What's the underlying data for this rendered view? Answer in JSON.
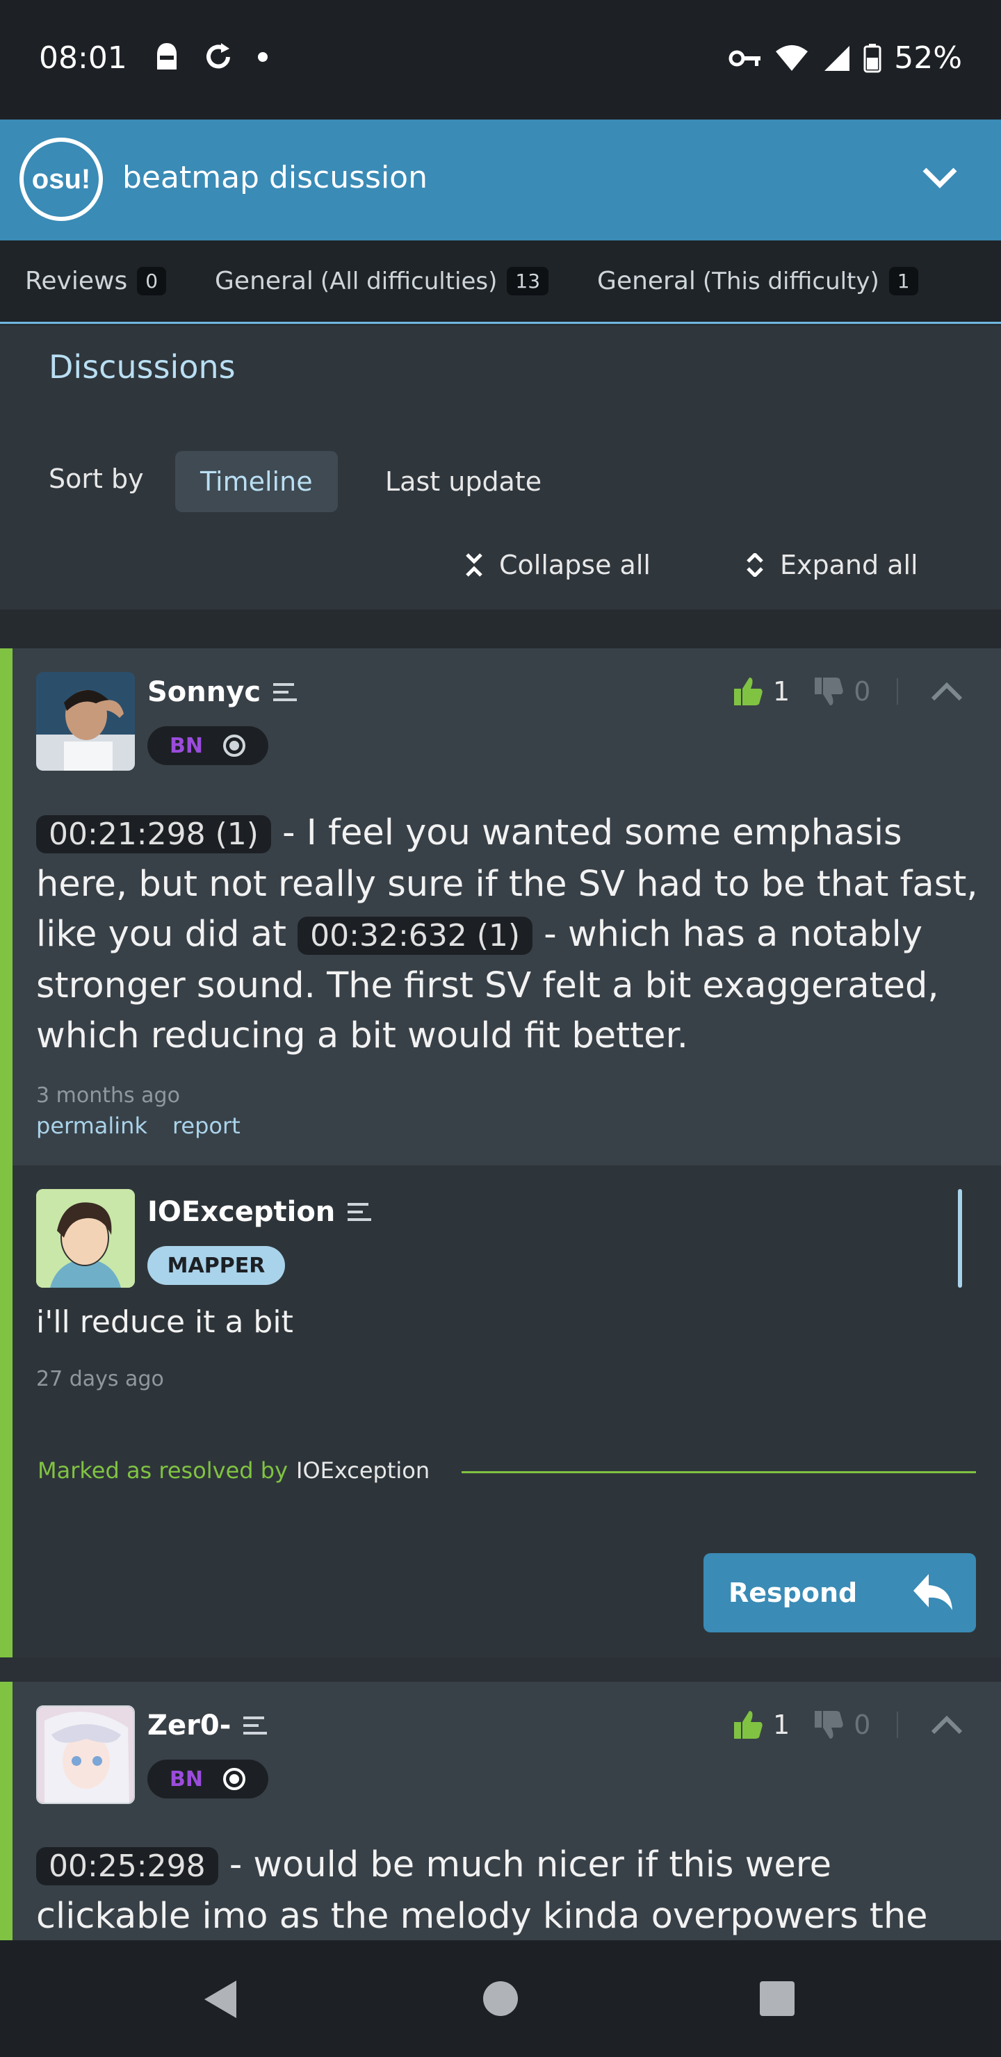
{
  "status_bar": {
    "time": "08:01",
    "battery": "52%"
  },
  "header": {
    "logo_text": "osu!",
    "title": "beatmap discussion"
  },
  "tabs": [
    {
      "label": "Reviews",
      "sub": "",
      "count": "0"
    },
    {
      "label": "General",
      "sub": "(All difficulties)",
      "count": "13"
    },
    {
      "label": "General",
      "sub": "(This difficulty)",
      "count": "1"
    }
  ],
  "discussions": {
    "title": "Discussions",
    "sort_label": "Sort by",
    "sort_options": [
      "Timeline",
      "Last update"
    ],
    "collapse_all": "Collapse all",
    "expand_all": "Expand all"
  },
  "posts": [
    {
      "username": "Sonnyc",
      "badge": "BN",
      "votes_up": "1",
      "votes_down": "0",
      "text_parts": [
        "00:21:298 (1)",
        " - I feel you wanted some emphasis here, but not really sure if the SV had to be that fast, like you did at ",
        "00:32:632 (1)",
        " - which has a notably stronger sound. The first SV felt a bit exaggerated, which reducing a bit would fit better."
      ],
      "time_ago": "3 months ago",
      "permalink": "permalink",
      "report": "report",
      "reply": {
        "username": "IOException",
        "badge": "MAPPER",
        "text": "i'll reduce it a bit",
        "time_ago": "27 days ago",
        "resolved_label": "Marked as resolved by",
        "resolved_by": "IOException",
        "respond": "Respond"
      }
    },
    {
      "username": "Zer0-",
      "badge": "BN",
      "votes_up": "1",
      "votes_down": "0",
      "text_parts": [
        "00:25:298",
        " - would be much nicer if this were clickable imo as the melody kinda overpowers the"
      ]
    }
  ],
  "colors": {
    "accent": "#3a8bb6",
    "resolved_green": "#80c342",
    "bn_purple": "#9b4cdb",
    "card_bg": "#394148"
  }
}
